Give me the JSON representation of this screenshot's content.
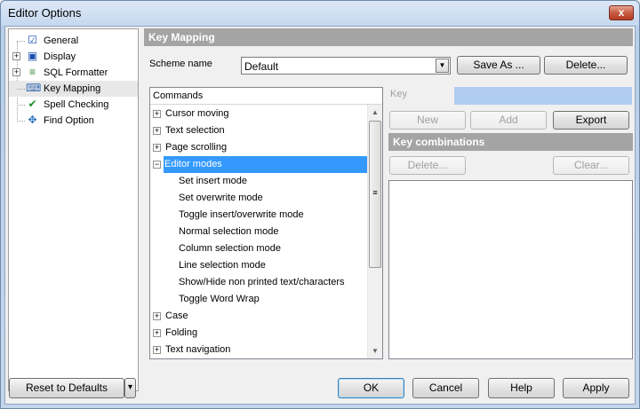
{
  "window": {
    "title": "Editor Options",
    "close_glyph": "x"
  },
  "tree": {
    "items": [
      {
        "label": "General",
        "icon": "general-icon",
        "glyph": "☑",
        "color": "#1c4fae",
        "expandable": false
      },
      {
        "label": "Display",
        "icon": "display-icon",
        "glyph": "▣",
        "color": "#1c4fae",
        "expandable": true
      },
      {
        "label": "SQL Formatter",
        "icon": "sql-formatter-icon",
        "glyph": "≡",
        "color": "#2c8a2c",
        "expandable": true
      },
      {
        "label": "Key Mapping",
        "icon": "key-mapping-icon",
        "glyph": "⌨",
        "color": "#3a6db5",
        "expandable": false,
        "selected": true
      },
      {
        "label": "Spell Checking",
        "icon": "spell-check-icon",
        "glyph": "✔",
        "color": "#1f8f2a",
        "expandable": false
      },
      {
        "label": "Find Option",
        "icon": "find-option-icon",
        "glyph": "✥",
        "color": "#2a6fb8",
        "expandable": false
      }
    ],
    "expand_glyph": "+"
  },
  "key_mapping": {
    "header": "Key Mapping",
    "scheme_label": "Scheme name",
    "scheme_value": "Default",
    "save_as": "Save As ...",
    "delete": "Delete..."
  },
  "commands": {
    "header": "Commands",
    "rows": [
      {
        "label": "Cursor moving",
        "level": 0,
        "pm": "+"
      },
      {
        "label": "Text selection",
        "level": 0,
        "pm": "+"
      },
      {
        "label": "Page scrolling",
        "level": 0,
        "pm": "+"
      },
      {
        "label": "Editor modes",
        "level": 0,
        "pm": "−",
        "selected": true
      },
      {
        "label": "Set insert mode",
        "level": 1
      },
      {
        "label": "Set overwrite mode",
        "level": 1
      },
      {
        "label": "Toggle insert/overwrite mode",
        "level": 1
      },
      {
        "label": "Normal selection mode",
        "level": 1
      },
      {
        "label": "Column selection mode",
        "level": 1
      },
      {
        "label": "Line selection mode",
        "level": 1
      },
      {
        "label": "Show/Hide non printed text/characters",
        "level": 1
      },
      {
        "label": "Toggle Word Wrap",
        "level": 1
      },
      {
        "label": "Case",
        "level": 0,
        "pm": "+"
      },
      {
        "label": "Folding",
        "level": 0,
        "pm": "+"
      },
      {
        "label": "Text navigation",
        "level": 0,
        "pm": "+"
      }
    ],
    "scroll_up": "▲",
    "scroll_down": "▼",
    "thumb_grip": "≡"
  },
  "key_panel": {
    "key_label": "Key",
    "new": "New",
    "add": "Add",
    "export": "Export",
    "combinations_header": "Key combinations",
    "delete": "Delete...",
    "clear": "Clear...",
    "key_field_color": "#b0ccf0"
  },
  "footer": {
    "reset": "Reset to Defaults",
    "dropdown_glyph": "▾",
    "ok": "OK",
    "cancel": "Cancel",
    "help": "Help",
    "apply": "Apply"
  }
}
